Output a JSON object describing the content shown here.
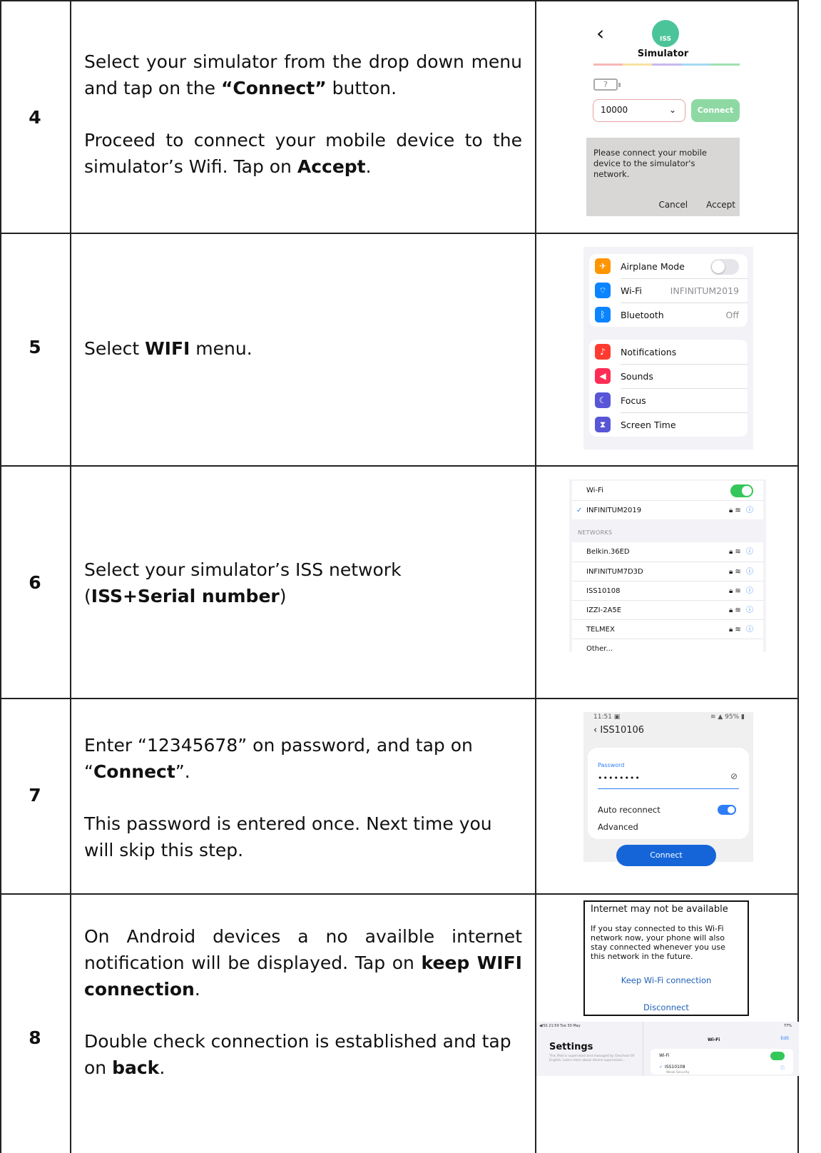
{
  "rows": [
    {
      "number": "4",
      "paragraphs": [
        {
          "before": "Select your simulator from the drop down menu and tap on the ",
          "bold": "“Connect”",
          "after": " button."
        },
        {
          "before": "Proceed to connect your mobile device to the simulator’s Wifi. Tap on ",
          "bold": "Accept",
          "after": "."
        }
      ],
      "screenshot": {
        "back_icon": "chevron-left-icon",
        "logo_text": "ISS",
        "title": "Simulator",
        "strip_colors": [
          "#f7b7b7",
          "#f7e3a0",
          "#c7b9ef",
          "#a5d8f2",
          "#9fe1b0"
        ],
        "battery_text": "?",
        "select_value": "10000",
        "connect_label": "Connect",
        "dialog_text": "Please connect your mobile device to the simulator's network.",
        "cancel_label": "Cancel",
        "accept_label": "Accept"
      }
    },
    {
      "number": "5",
      "paragraphs": [
        {
          "before": "Select ",
          "bold": "WIFI",
          "after": " menu."
        }
      ],
      "screenshot": {
        "group1": [
          {
            "label": "Airplane Mode",
            "icon": "airplane-icon",
            "icon_color": "#ff9500",
            "glyph": "✈",
            "value": "",
            "toggle": true
          },
          {
            "label": "Wi-Fi",
            "icon": "wifi-icon",
            "icon_color": "#0a84ff",
            "glyph": "⌔",
            "value": "INFINITUM2019"
          },
          {
            "label": "Bluetooth",
            "icon": "bluetooth-icon",
            "icon_color": "#0a84ff",
            "glyph": "ᛒ",
            "value": "Off"
          }
        ],
        "group2": [
          {
            "label": "Notifications",
            "icon": "bell-icon",
            "icon_color": "#ff3b30",
            "glyph": "♪"
          },
          {
            "label": "Sounds",
            "icon": "speaker-icon",
            "icon_color": "#ff2d55",
            "glyph": "◀"
          },
          {
            "label": "Focus",
            "icon": "moon-icon",
            "icon_color": "#5856d6",
            "glyph": "☾"
          },
          {
            "label": "Screen Time",
            "icon": "hourglass-icon",
            "icon_color": "#5856d6",
            "glyph": "⧗"
          }
        ]
      }
    },
    {
      "number": "6",
      "paragraphs": [
        {
          "before": "Select your simulator’s ISS network",
          "bold": "",
          "after": ""
        },
        {
          "before": "(",
          "bold": "ISS+Serial number",
          "after": ")"
        }
      ],
      "screenshot": {
        "wifi_label": "Wi-Fi",
        "connected": "INFINITUM2019",
        "section": "NETWORKS",
        "networks": [
          "Belkin.36ED",
          "INFINITUM7D3D",
          "ISS10108",
          "IZZI-2A5E",
          "TELMEX",
          "Other..."
        ]
      }
    },
    {
      "number": "7",
      "paragraphs": [
        {
          "before": "Enter “12345678” on password, and tap on “",
          "bold": "Connect",
          "after": "”."
        },
        {
          "before": "This password is entered once. Next time you will skip this step.",
          "bold": "",
          "after": ""
        }
      ],
      "screenshot": {
        "time": "11:51",
        "battery": "95%",
        "ssid": "ISS10106",
        "password_label": "Password",
        "password_dots": "••••••••",
        "auto_reconnect": "Auto reconnect",
        "advanced": "Advanced",
        "connect": "Connect"
      }
    },
    {
      "number": "8",
      "paragraphs": [
        {
          "before": "On Android devices a no availble internet notification will be displayed. Tap on ",
          "bold": "keep WIFI connection",
          "after": "."
        },
        {
          "before": "Double check connection is established and tap on ",
          "bold": "back",
          "after": "."
        }
      ],
      "screenshot": {
        "notice_title": "Internet may not be available",
        "notice_body": "If you stay connected to this Wi-Fi network now, your phone will also stay connected whenever you use this network in the future.",
        "keep": "Keep Wi-Fi connection",
        "disconnect": "Disconnect",
        "ipad_status": "◀ISS 21:59 Tue 30 May",
        "ipad_battery": "77%",
        "ipad_settings": "Settings",
        "ipad_small": "This iPad is supervised and managed by Oxschool Of English. Learn more about device supervision...",
        "ipad_header": "Wi-Fi",
        "ipad_edit": "Edit",
        "ipad_wifi": "Wi-Fi",
        "ipad_network": "ISS10108",
        "ipad_security": "Weak Security"
      }
    }
  ]
}
